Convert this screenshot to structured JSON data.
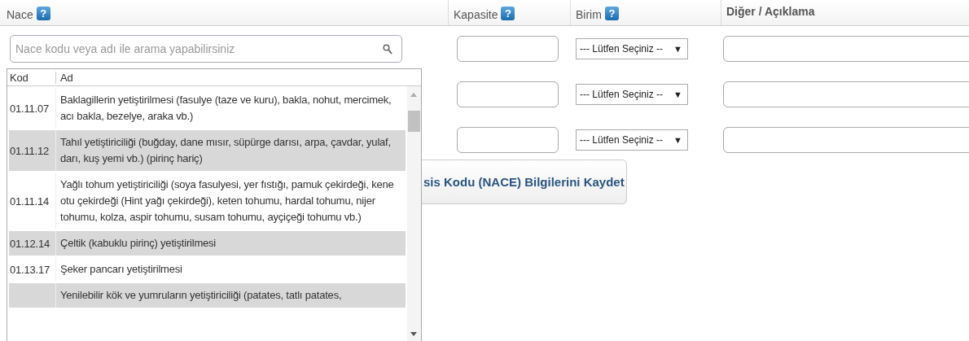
{
  "columns": [
    {
      "label": "Nace",
      "help": "?"
    },
    {
      "label": "Kapasite",
      "help": "?"
    },
    {
      "label": "Birim",
      "help": "?"
    },
    {
      "label": "Diğer / Açıklama"
    }
  ],
  "search": {
    "placeholder": "Nace kodu veya adı ile arama yapabilirsiniz"
  },
  "rows": [
    {
      "unit": "--- Lütfen Seçiniz --",
      "caret": "▼"
    },
    {
      "unit": "--- Lütfen Seçiniz --",
      "caret": "▼"
    },
    {
      "unit": "--- Lütfen Seçiniz --",
      "caret": "▼"
    }
  ],
  "dropdown": {
    "columns": [
      "Kod",
      "Ad"
    ],
    "items": [
      {
        "code": "01.11.07",
        "name": "Baklagillerin yetiştirilmesi (fasulye (taze ve kuru), bakla, nohut, mercimek, acı bakla, bezelye, araka vb.)"
      },
      {
        "code": "01.11.12",
        "name": "Tahıl yetiştiriciliği (buğday, dane mısır, süpürge darısı, arpa, çavdar, yulaf, darı, kuş yemi vb.) (pirinç hariç)"
      },
      {
        "code": "01.11.14",
        "name": "Yağlı tohum yetiştiriciliği (soya fasulyesi, yer fıstığı, pamuk çekirdeği, kene otu çekirdeği (Hint yağı çekirdeği), keten tohumu, hardal tohumu, nijer tohumu, kolza, aspir tohumu, susam tohumu, ayçiçeği tohumu vb.)"
      },
      {
        "code": "01.12.14",
        "name": "Çeltik (kabuklu pirinç) yetiştirilmesi"
      },
      {
        "code": "01.13.17",
        "name": "Şeker pancarı yetiştirilmesi"
      },
      {
        "name": "Yenilebilir kök ve yumruların yetiştiriciliği (patates, tatlı patates,"
      }
    ]
  },
  "save_button": {
    "label": "sis Kodu (NACE) Bilgilerini Kaydet"
  }
}
